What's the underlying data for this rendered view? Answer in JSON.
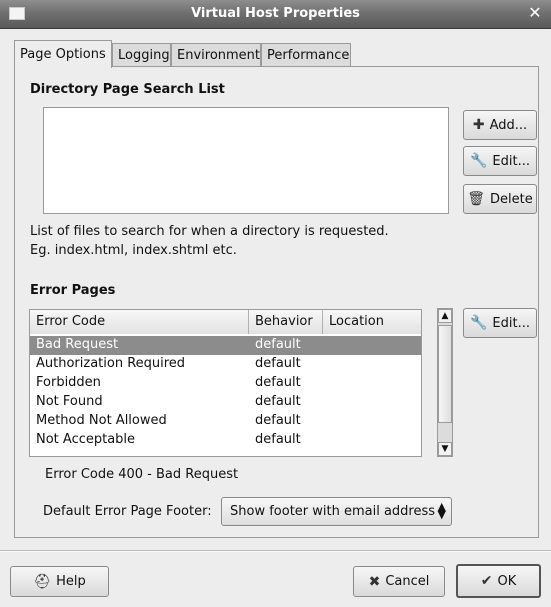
{
  "window": {
    "title": "Virtual Host Properties"
  },
  "tabs": [
    {
      "label": "Page Options"
    },
    {
      "label": "Logging"
    },
    {
      "label": "Environment"
    },
    {
      "label": "Performance"
    }
  ],
  "directory_section": {
    "title": "Directory Page Search List",
    "add_label": "Add...",
    "edit_label": "Edit...",
    "delete_label": "Delete",
    "description_line1": "List of files to search for when a directory is requested.",
    "description_line2": "Eg. index.html, index.shtml etc."
  },
  "error_section": {
    "title": "Error Pages",
    "columns": [
      "Error Code",
      "Behavior",
      "Location"
    ],
    "rows": [
      {
        "code": "Bad Request",
        "behavior": "default",
        "location": ""
      },
      {
        "code": "Authorization Required",
        "behavior": "default",
        "location": ""
      },
      {
        "code": "Forbidden",
        "behavior": "default",
        "location": ""
      },
      {
        "code": "Not Found",
        "behavior": "default",
        "location": ""
      },
      {
        "code": "Method Not Allowed",
        "behavior": "default",
        "location": ""
      },
      {
        "code": "Not Acceptable",
        "behavior": "default",
        "location": ""
      }
    ],
    "edit_label": "Edit...",
    "status": "Error Code 400 - Bad Request",
    "footer_label": "Default Error Page Footer:",
    "footer_value": "Show footer with email address"
  },
  "footer_buttons": {
    "help": "Help",
    "cancel": "Cancel",
    "ok": "OK"
  },
  "icons": {
    "add": "plus-icon",
    "edit": "wrench-icon",
    "delete": "trash-icon",
    "help": "help-icon",
    "cancel": "x-icon",
    "ok": "check-icon"
  }
}
